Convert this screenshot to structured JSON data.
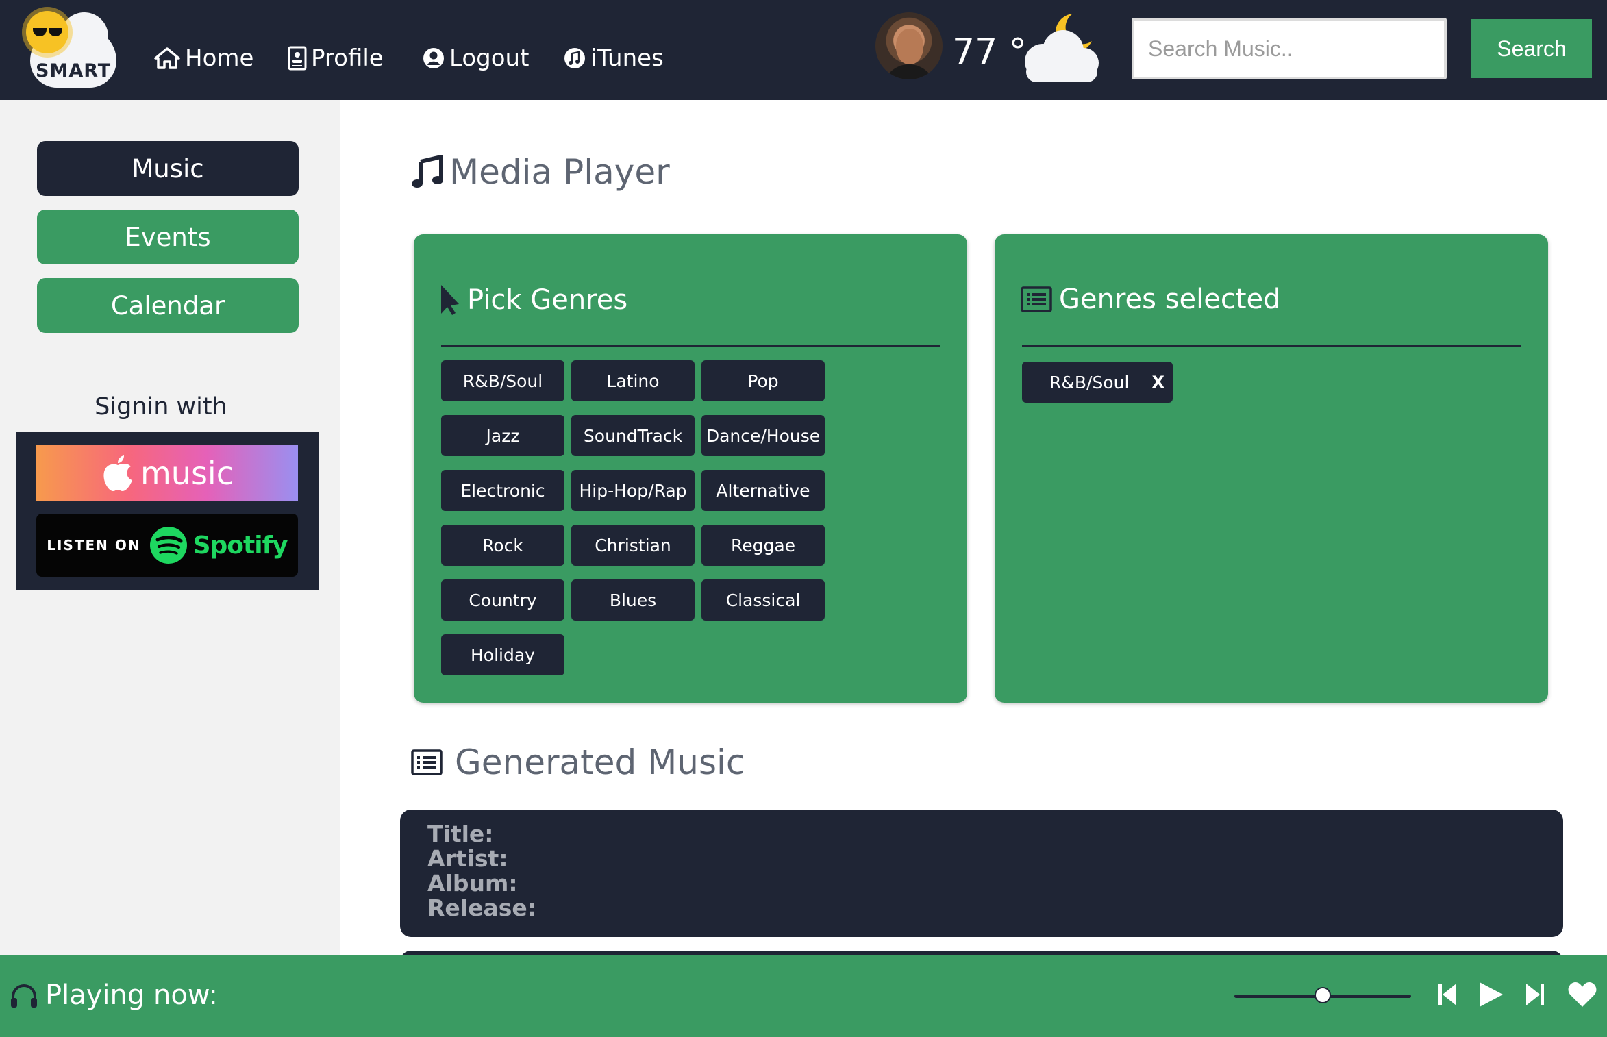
{
  "app": {
    "logo_text": "SMART"
  },
  "nav": {
    "home": "Home",
    "profile": "Profile",
    "logout": "Logout",
    "itunes": "iTunes"
  },
  "weather": {
    "temperature": "77 °",
    "icon": "moon-cloud-icon"
  },
  "search": {
    "placeholder": "Search Music..",
    "value": "",
    "button": "Search"
  },
  "sidebar": {
    "items": [
      {
        "label": "Music",
        "active": true
      },
      {
        "label": "Events",
        "active": false
      },
      {
        "label": "Calendar",
        "active": false
      }
    ],
    "signin_label": "Signin with",
    "apple_music": "music",
    "spotify_listen": "LISTEN ON",
    "spotify_brand": "Spotify"
  },
  "media_player": {
    "title": "Media Player",
    "pick_genres": {
      "title": "Pick Genres",
      "genres": [
        [
          "R&B/Soul",
          "Latino",
          "Pop"
        ],
        [
          "Jazz",
          "SoundTrack",
          "Dance/House"
        ],
        [
          "Electronic",
          "Hip-Hop/Rap",
          "Alternative"
        ],
        [
          "Rock",
          "Christian",
          "Reggae"
        ],
        [
          "Country",
          "Blues",
          "Classical"
        ],
        [
          "Holiday"
        ]
      ]
    },
    "genres_selected": {
      "title": "Genres selected",
      "items": [
        {
          "label": "R&B/Soul",
          "remove": "X"
        }
      ]
    }
  },
  "generated_music": {
    "title": "Generated Music",
    "fields": {
      "title": "Title:",
      "artist": "Artist:",
      "album": "Album:",
      "release": "Release:"
    }
  },
  "player": {
    "now_playing": "Playing now:",
    "volume_fraction": 0.5
  },
  "colors": {
    "navy": "#1f2535",
    "green": "#3a9b62",
    "sidebar_bg": "#f2f2f2"
  }
}
